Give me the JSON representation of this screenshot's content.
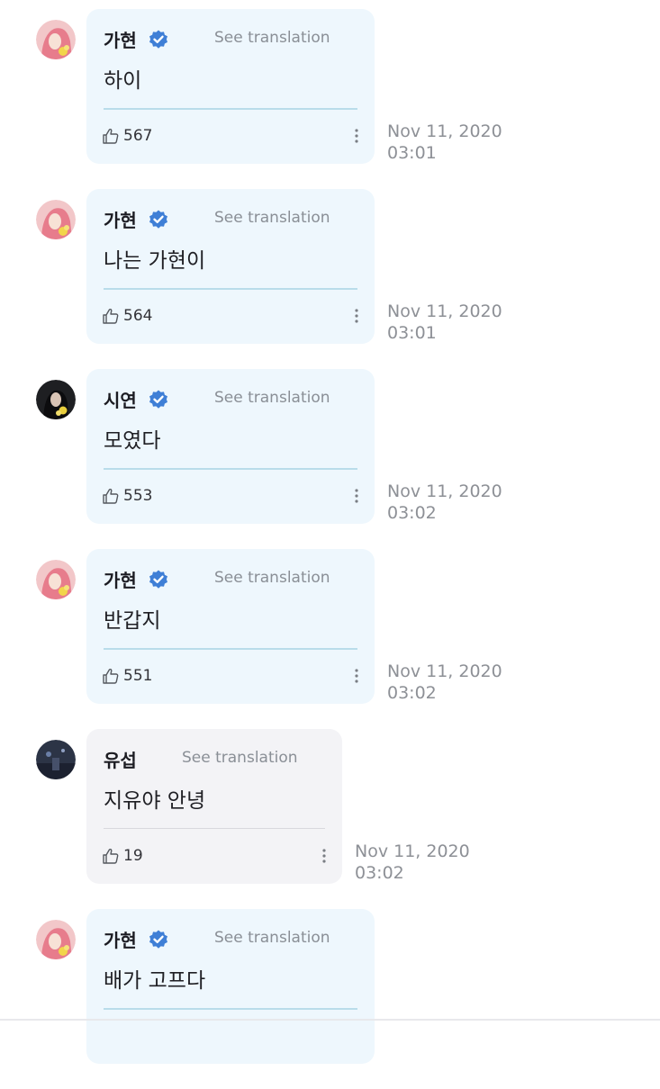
{
  "comments": [
    {
      "author": "가현",
      "verified": true,
      "avatar": "gahyeon",
      "see_translation": "See translation",
      "message": "하이",
      "likes": "567",
      "date": "Nov 11, 2020",
      "time": "03:01"
    },
    {
      "author": "가현",
      "verified": true,
      "avatar": "gahyeon",
      "see_translation": "See translation",
      "message": "나는 가현이",
      "likes": "564",
      "date": "Nov 11, 2020",
      "time": "03:01"
    },
    {
      "author": "시연",
      "verified": true,
      "avatar": "siyeon",
      "see_translation": "See translation",
      "message": "모였다",
      "likes": "553",
      "date": "Nov 11, 2020",
      "time": "03:02"
    },
    {
      "author": "가현",
      "verified": true,
      "avatar": "gahyeon",
      "see_translation": "See translation",
      "message": "반갑지",
      "likes": "551",
      "date": "Nov 11, 2020",
      "time": "03:02"
    },
    {
      "author": "유섭",
      "verified": false,
      "avatar": "fan",
      "see_translation": "See translation",
      "message": "지유야 안녕",
      "likes": "19",
      "date": "Nov 11, 2020",
      "time": "03:02"
    },
    {
      "author": "가현",
      "verified": true,
      "avatar": "gahyeon",
      "see_translation": "See translation",
      "message": "배가 고프다",
      "likes": "",
      "date": "",
      "time": ""
    }
  ],
  "colors": {
    "artist_bubble": "#eef7fd",
    "fan_bubble": "#f3f3f6",
    "verified_badge": "#3f7fd6",
    "muted_text": "#8d9096"
  },
  "icons": {
    "verified": "verified-badge-icon",
    "like": "thumbs-up-icon",
    "more": "more-vertical-icon"
  }
}
